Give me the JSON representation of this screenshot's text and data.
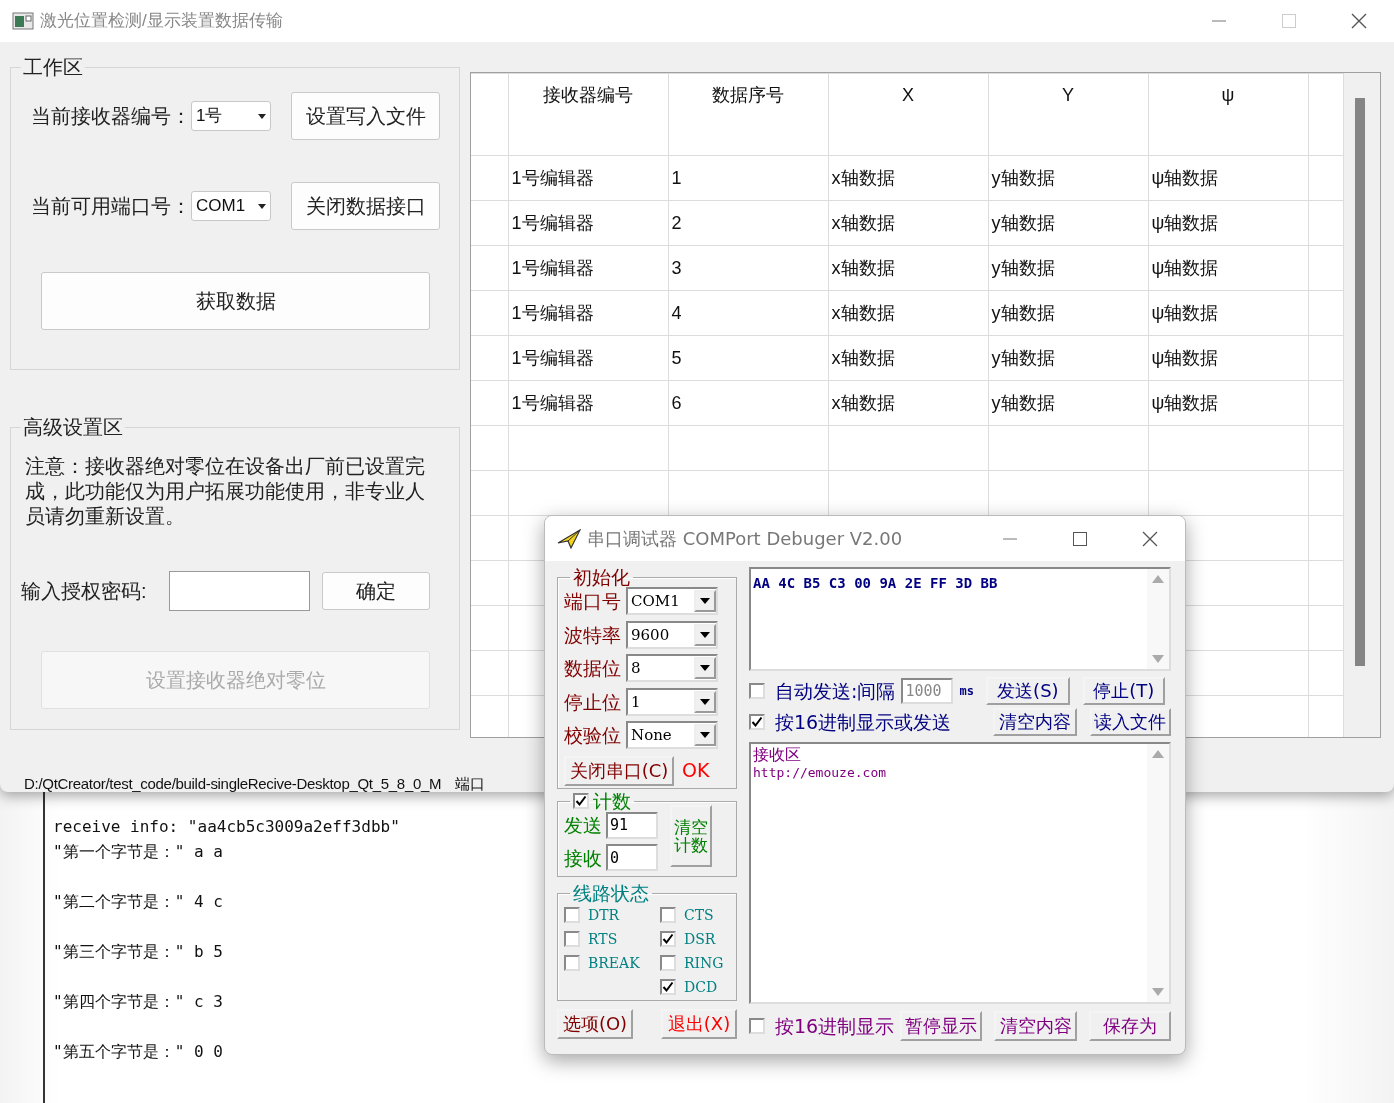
{
  "window": {
    "title": "激光位置检测/显示装置数据传输"
  },
  "work_area": {
    "title": "工作区",
    "receiver_label": "当前接收器编号：",
    "receiver_value": "1号",
    "write_button": "设置写入文件",
    "port_label": "当前可用端口号：",
    "port_value": "COM1",
    "close_button": "关闭数据接口",
    "fetch_button": "获取数据"
  },
  "advanced_area": {
    "title": "高级设置区",
    "notice": "注意：接收器绝对零位在设备出厂前已设置完成，此功能仅为用户拓展功能使用，非专业人员请勿重新设置。",
    "password_label": "输入授权密码:",
    "confirm_button": "确定",
    "zero_button": {
      "label": "设置接收器绝对零位",
      "disabled": true
    }
  },
  "table": {
    "columns": [
      "接收器编号",
      "数据序号",
      "X",
      "Y",
      "ψ"
    ],
    "rows": [
      [
        "1号编辑器",
        "1",
        "x轴数据",
        "y轴数据",
        "ψ轴数据"
      ],
      [
        "1号编辑器",
        "2",
        "x轴数据",
        "y轴数据",
        "ψ轴数据"
      ],
      [
        "1号编辑器",
        "3",
        "x轴数据",
        "y轴数据",
        "ψ轴数据"
      ],
      [
        "1号编辑器",
        "4",
        "x轴数据",
        "y轴数据",
        "ψ轴数据"
      ],
      [
        "1号编辑器",
        "5",
        "x轴数据",
        "y轴数据",
        "ψ轴数据"
      ],
      [
        "1号编辑器",
        "6",
        "x轴数据",
        "y轴数据",
        "ψ轴数据"
      ]
    ]
  },
  "status_bar": {
    "path": "D:/QtCreator/test_code/build-singleRecive-Desktop_Qt_5_8_0_M",
    "port_status": "端口"
  },
  "console": {
    "lines": [
      "receive info: \"aa4cb5c3009a2eff3dbb\"",
      "\"第一个字节是：\" a a",
      "\"第二个字节是：\" 4 c",
      "\"第三个字节是：\" b 5",
      "\"第四个字节是：\" c 3",
      "\"第五个字节是：\" 0 0"
    ]
  },
  "debugger": {
    "title": "串口调试器 COMPort Debuger V2.00",
    "init_group": {
      "title": "初始化",
      "fields": [
        {
          "label": "端口号",
          "value": "COM1"
        },
        {
          "label": "波特率",
          "value": "9600"
        },
        {
          "label": "数据位",
          "value": "8"
        },
        {
          "label": "停止位",
          "value": "1"
        },
        {
          "label": "校验位",
          "value": "None"
        }
      ],
      "port_button": "关闭串口(C)",
      "port_state": "OK"
    },
    "count_group": {
      "title": "计数",
      "checked": true,
      "sent_label": "发送",
      "sent_value": "91",
      "received_label": "接收",
      "received_value": "0",
      "clear_button": "清空计数"
    },
    "line_status": {
      "title": "线路状态",
      "left_signals": [
        {
          "label": "DTR",
          "checked": false
        },
        {
          "label": "RTS",
          "checked": false
        },
        {
          "label": "BREAK",
          "checked": false
        }
      ],
      "right_signals": [
        {
          "label": "CTS",
          "checked": false
        },
        {
          "label": "DSR",
          "checked": true
        },
        {
          "label": "RING",
          "checked": false
        },
        {
          "label": "DCD",
          "checked": true
        }
      ]
    },
    "options_button": "选项(O)",
    "exit_button": "退出(X)",
    "send_text": "AA 4C B5 C3 00 9A 2E FF 3D BB",
    "auto_send": {
      "label": "自动发送:间隔",
      "checked": false,
      "interval": "1000",
      "unit": "ms"
    },
    "send_button": "发送(S)",
    "stop_button": "停止(T)",
    "hex_send": {
      "label": "按16进制显示或发送",
      "checked": true
    },
    "clear_send_button": "清空内容",
    "load_button": "读入文件",
    "receive_lines": [
      "接收区",
      "http://emouze.com"
    ],
    "hex_display": {
      "label": "按16进制显示",
      "checked": false
    },
    "pause_button": "暂停显示",
    "clear_receive_button": "清空内容",
    "save_button": "保存为"
  }
}
